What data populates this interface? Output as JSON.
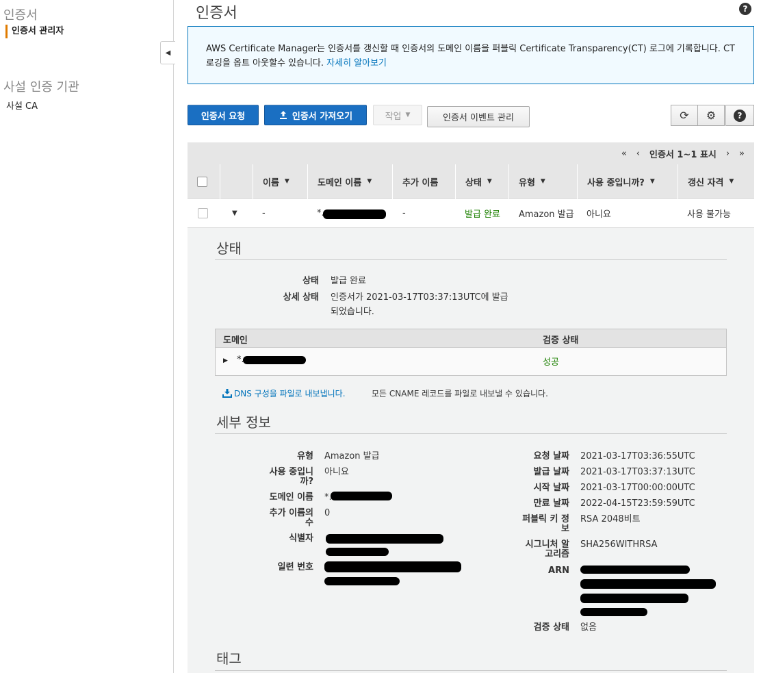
{
  "sidebar": {
    "section1_title": "인증서",
    "section1_item": "인증서 관리자",
    "section2_title": "사설 인증 기관",
    "section2_item": "사설 CA"
  },
  "page": {
    "title": "인증서",
    "help": "?"
  },
  "info": {
    "text": "AWS Certificate Manager는 인증서를 갱신할 때 인증서의 도메인 이름을 퍼블릭 Certificate Transparency(CT) 로그에 기록합니다. CT 로깅을 옵트 아웃할수 있습니다.",
    "link": "자세히 알아보기"
  },
  "toolbar": {
    "request": "인증서 요청",
    "import": "인증서 가져오기",
    "actions": "작업",
    "events": "인증서 이벤트 관리"
  },
  "pager": {
    "label": "인증서 1~1 표시"
  },
  "table": {
    "headers": [
      "이름",
      "도메인 이름",
      "추가 이름",
      "상태",
      "유형",
      "사용 중입니까?",
      "갱신 자격"
    ],
    "row": {
      "name": "-",
      "domain": "*.",
      "additional": "-",
      "status": "발급 완료",
      "type": "Amazon 발급",
      "in_use": "아니요",
      "renewal": "사용 불가능"
    }
  },
  "status_section": {
    "title": "상태",
    "status_label": "상태",
    "status_value": "발급 완료",
    "detail_label": "상세 상태",
    "detail_value_1": "인증서가 2021-03-17T03:37:13UTC에 발급",
    "detail_value_2": "되었습니다.",
    "domain_col": "도메인",
    "validation_col": "검증 상태",
    "domain_value": "*.",
    "validation_value": "성공",
    "dns_link": "DNS 구성을 파일로 내보냅니다.",
    "dns_note": "모든 CNAME 레코드를 파일로 내보낼 수 있습니다."
  },
  "details": {
    "title": "세부 정보",
    "type_label": "유형",
    "type_value": "Amazon 발급",
    "in_use_label_1": "사용 중입니",
    "in_use_label_2": "까?",
    "in_use_value": "아니요",
    "domain_label": "도메인 이름",
    "domain_value": "*.",
    "add_label_1": "추가 이름의",
    "add_label_2": "수",
    "add_value": "0",
    "id_label": "식별자",
    "serial_label": "일련 번호",
    "requested_label": "요청 날짜",
    "requested_value": "2021-03-17T03:36:55UTC",
    "issued_label": "발급 날짜",
    "issued_value": "2021-03-17T03:37:13UTC",
    "start_label": "시작 날짜",
    "start_value": "2021-03-17T00:00:00UTC",
    "expire_label": "만료 날짜",
    "expire_value": "2022-04-15T23:59:59UTC",
    "pubkey_label_1": "퍼블릭 키 정",
    "pubkey_label_2": "보",
    "pubkey_value": "RSA 2048비트",
    "sig_label_1": "시그니처 알",
    "sig_label_2": "고리즘",
    "sig_value": "SHA256WITHRSA",
    "arn_label": "ARN",
    "validation_label": "검증 상태",
    "validation_value": "없음"
  },
  "tags": {
    "title": "태그"
  },
  "colors": {
    "primary": "#1a6fc2",
    "success": "#1d8102",
    "info_border": "#0073bb",
    "accent": "#e07b00"
  }
}
